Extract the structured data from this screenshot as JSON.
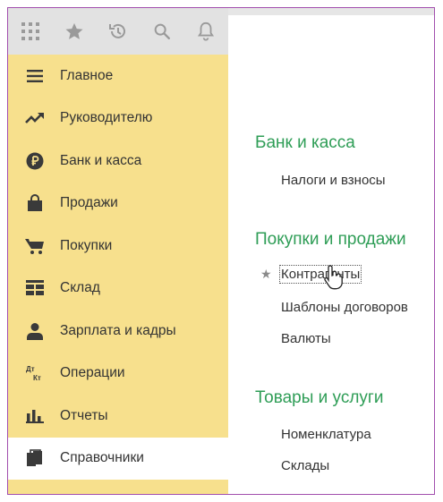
{
  "toolbar": {
    "icons": [
      "apps-grid-icon",
      "star-icon",
      "history-icon",
      "search-icon",
      "bell-icon"
    ]
  },
  "sidebar": {
    "items": [
      {
        "label": "Главное",
        "icon": "menu-lines-icon"
      },
      {
        "label": "Руководителю",
        "icon": "trend-up-icon"
      },
      {
        "label": "Банк и касса",
        "icon": "ruble-coin-icon"
      },
      {
        "label": "Продажи",
        "icon": "shopping-bag-icon"
      },
      {
        "label": "Покупки",
        "icon": "cart-icon"
      },
      {
        "label": "Склад",
        "icon": "warehouse-icon"
      },
      {
        "label": "Зарплата и кадры",
        "icon": "person-icon"
      },
      {
        "label": "Операции",
        "icon": "debit-credit-icon",
        "icon_text_top": "Дт",
        "icon_text_bottom": "Кт"
      },
      {
        "label": "Отчеты",
        "icon": "bar-chart-icon"
      },
      {
        "label": "Справочники",
        "icon": "books-icon",
        "active": true
      }
    ]
  },
  "main": {
    "sections": [
      {
        "title": "Банк и касса",
        "links": [
          "Налоги и взносы"
        ]
      },
      {
        "title": "Покупки и продажи",
        "links": [
          "Контрагенты",
          "Шаблоны договоров",
          "Валюты"
        ]
      },
      {
        "title": "Товары и услуги",
        "links": [
          "Номенклатура",
          "Склады"
        ]
      }
    ]
  },
  "colors": {
    "sidebar_bg": "#f7e08d",
    "section_title": "#2e9d56",
    "frame_border": "#a24fae",
    "toolbar_bg": "#e2e2e2"
  }
}
